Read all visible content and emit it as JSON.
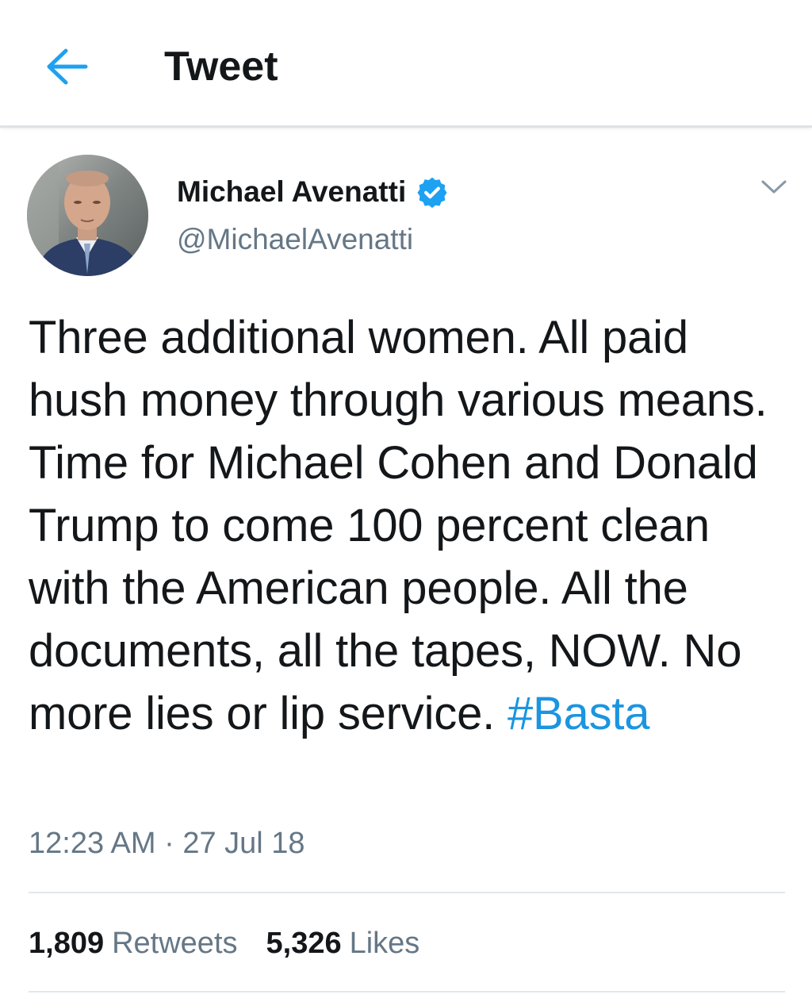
{
  "header": {
    "back_icon": "arrow-left-icon",
    "title": "Tweet"
  },
  "tweet": {
    "author": {
      "name": "Michael Avenatti",
      "handle": "@MichaelAvenatti",
      "verified": true
    },
    "text": "Three additional women. All paid hush money through various means. Time for Michael Cohen and Donald Trump to come 100 percent clean with the American people. All the documents, all the tapes, NOW. No more lies or lip service.",
    "hashtag": "#Basta",
    "timestamp": "12:23 AM · 27 Jul 18",
    "stats": {
      "retweets_count": "1,809",
      "retweets_label": "Retweets",
      "likes_count": "5,326",
      "likes_label": "Likes"
    }
  },
  "colors": {
    "accent": "#1da1f2",
    "hashtag": "#1b95e0",
    "text_primary": "#14171a",
    "text_secondary": "#657786",
    "divider": "#e1e8ed"
  }
}
